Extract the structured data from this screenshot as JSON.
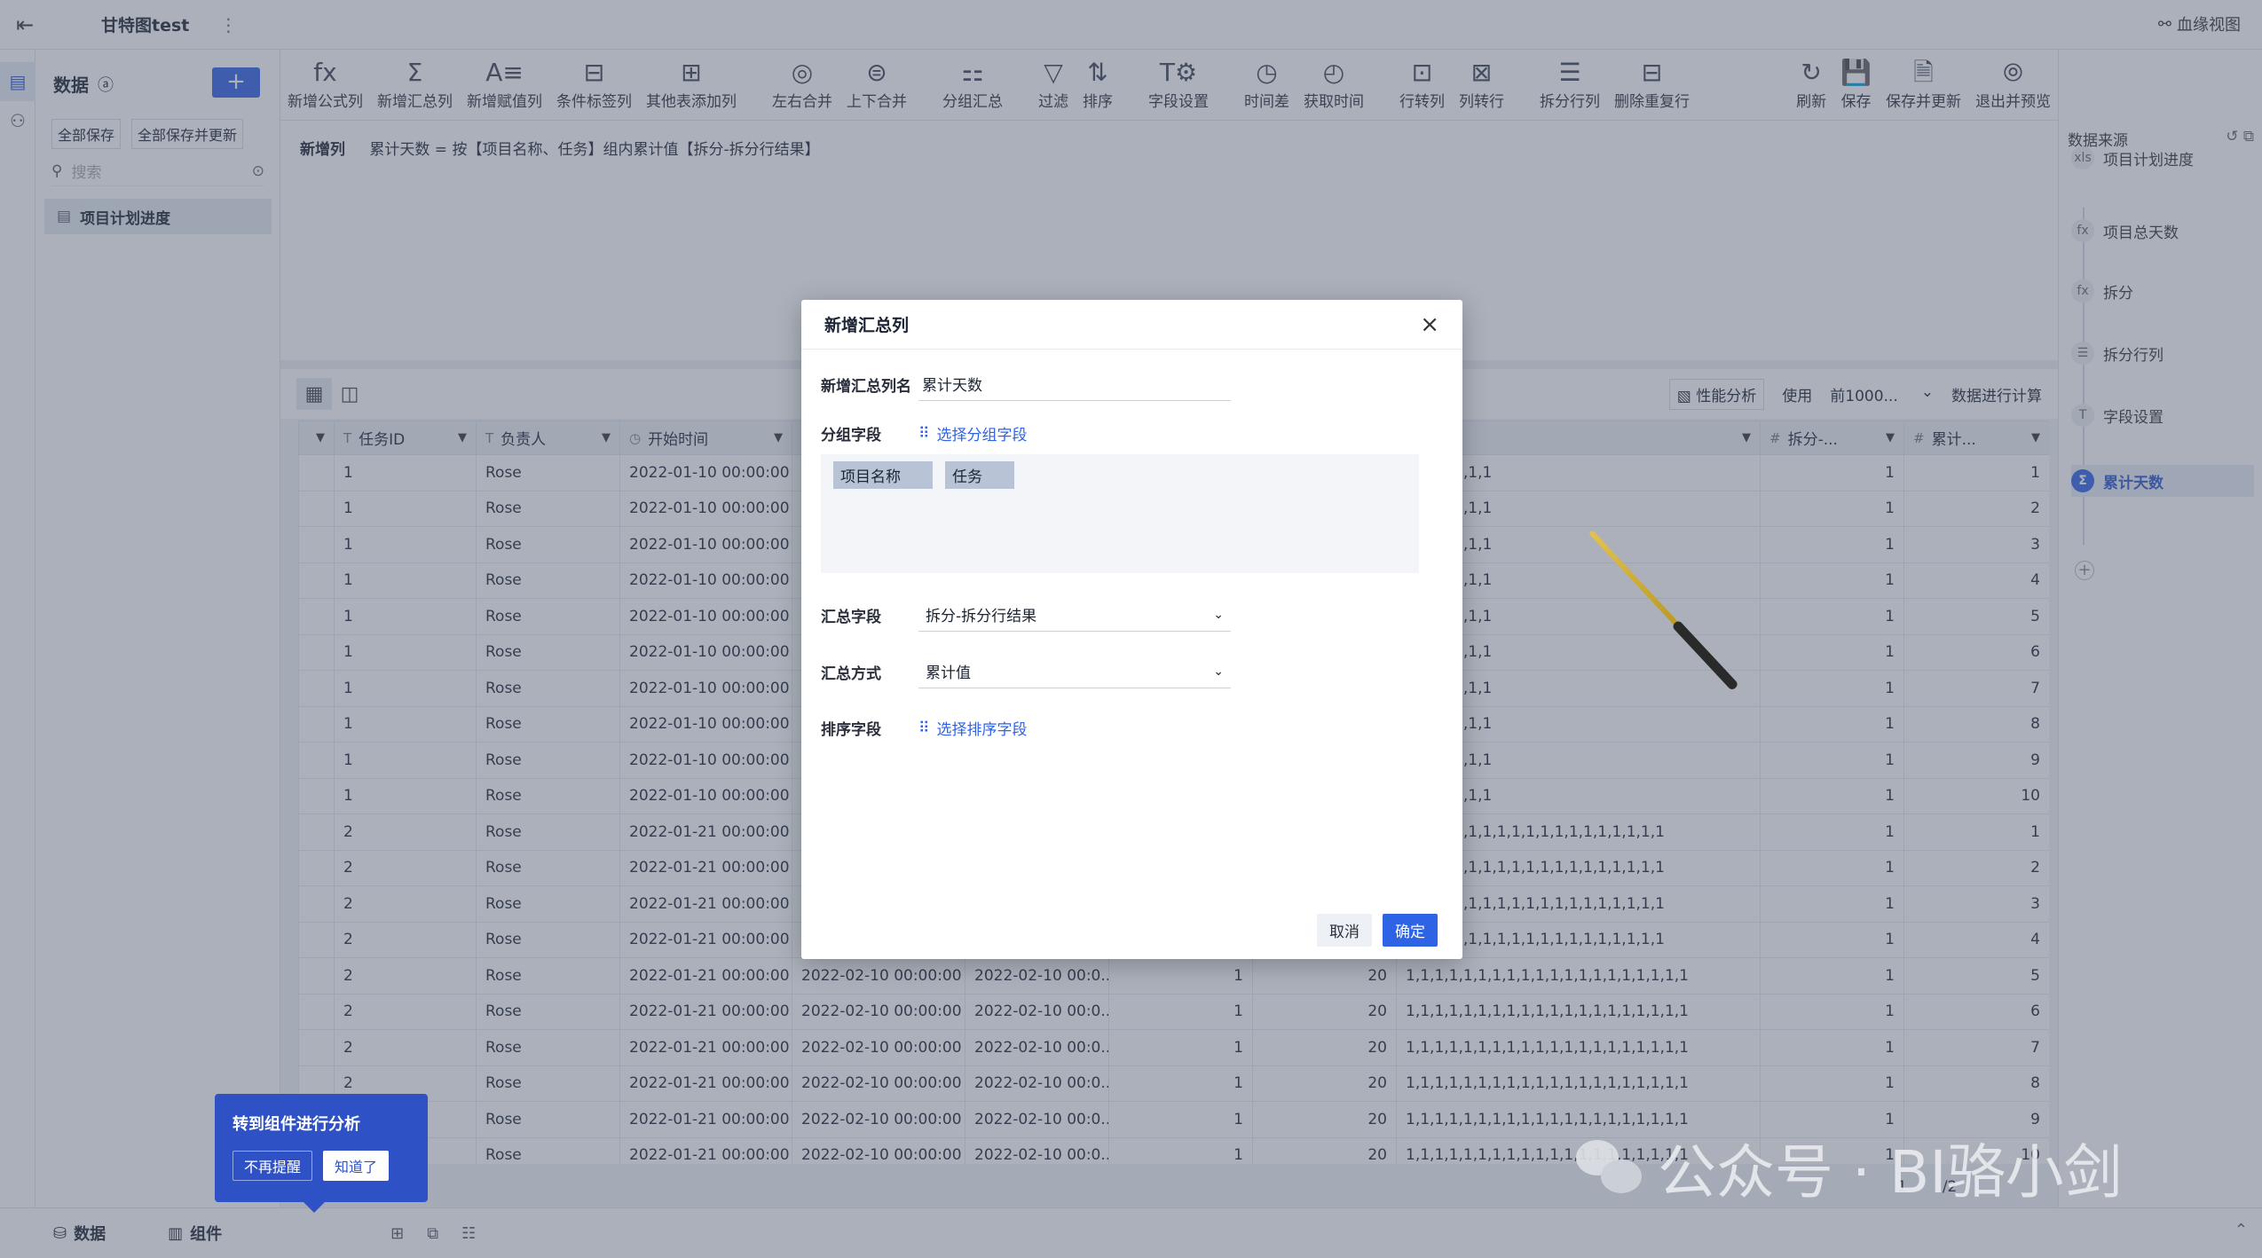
{
  "topbar": {
    "title": "甘特图test",
    "lineage": "血缘视图"
  },
  "left_panel": {
    "header": "数据",
    "add": "+",
    "save_all": "全部保存",
    "save_all_update": "全部保存并更新",
    "search_placeholder": "搜索",
    "table_name": "项目计划进度"
  },
  "toolbar": {
    "items": [
      {
        "label": "新增公式列",
        "icon": "fx"
      },
      {
        "label": "新增汇总列",
        "icon": "Σ"
      },
      {
        "label": "新增赋值列",
        "icon": "A≡"
      },
      {
        "label": "条件标签列",
        "icon": "⊟"
      },
      {
        "label": "其他表添加列",
        "icon": "⊞"
      },
      {
        "label": "左右合并",
        "icon": "◎"
      },
      {
        "label": "上下合并",
        "icon": "⊜"
      },
      {
        "label": "分组汇总",
        "icon": "⚏"
      },
      {
        "label": "过滤",
        "icon": "▽"
      },
      {
        "label": "排序",
        "icon": "⇅"
      },
      {
        "label": "字段设置",
        "icon": "T⚙"
      },
      {
        "label": "时间差",
        "icon": "◷"
      },
      {
        "label": "获取时间",
        "icon": "◴"
      },
      {
        "label": "行转列",
        "icon": "⊡"
      },
      {
        "label": "列转行",
        "icon": "⊠"
      },
      {
        "label": "拆分行列",
        "icon": "☰"
      },
      {
        "label": "删除重复行",
        "icon": "⊟"
      },
      {
        "label": "刷新",
        "icon": "↻"
      },
      {
        "label": "保存",
        "icon": "💾"
      },
      {
        "label": "保存并更新",
        "icon": "🗎"
      },
      {
        "label": "退出并预览",
        "icon": "⦾"
      }
    ]
  },
  "formula_bar": {
    "label": "新增列",
    "text": "累计天数 = 按【项目名称、任务】组内累计值【拆分-拆分行结果】"
  },
  "grid_controls": {
    "perf": "性能分析",
    "use": "使用",
    "rows": "前1000...",
    "compute": "数据进行计算"
  },
  "grid": {
    "headers": [
      {
        "label": "",
        "type": ""
      },
      {
        "label": "任务ID",
        "type": "T"
      },
      {
        "label": "负责人",
        "type": "T"
      },
      {
        "label": "开始时间",
        "type": "◷"
      },
      {
        "label": "",
        "type": ""
      },
      {
        "label": "",
        "type": ""
      },
      {
        "label": "",
        "type": ""
      },
      {
        "label": "",
        "type": ""
      },
      {
        "label": "分",
        "type": ""
      },
      {
        "label": "拆分-...",
        "type": "#"
      },
      {
        "label": "累计...",
        "type": "#"
      }
    ],
    "rows": [
      [
        "",
        "1",
        "Rose",
        "2022-01-10 00:00:00",
        "",
        "",
        "",
        "",
        ",1,1,1,1,1,1",
        "1",
        "1"
      ],
      [
        "",
        "1",
        "Rose",
        "2022-01-10 00:00:00",
        "",
        "",
        "",
        "",
        ",1,1,1,1,1,1",
        "1",
        "2"
      ],
      [
        "",
        "1",
        "Rose",
        "2022-01-10 00:00:00",
        "",
        "",
        "",
        "",
        ",1,1,1,1,1,1",
        "1",
        "3"
      ],
      [
        "",
        "1",
        "Rose",
        "2022-01-10 00:00:00",
        "",
        "",
        "",
        "",
        ",1,1,1,1,1,1",
        "1",
        "4"
      ],
      [
        "",
        "1",
        "Rose",
        "2022-01-10 00:00:00",
        "",
        "",
        "",
        "",
        ",1,1,1,1,1,1",
        "1",
        "5"
      ],
      [
        "",
        "1",
        "Rose",
        "2022-01-10 00:00:00",
        "",
        "",
        "",
        "",
        ",1,1,1,1,1,1",
        "1",
        "6"
      ],
      [
        "",
        "1",
        "Rose",
        "2022-01-10 00:00:00",
        "",
        "",
        "",
        "",
        ",1,1,1,1,1,1",
        "1",
        "7"
      ],
      [
        "",
        "1",
        "Rose",
        "2022-01-10 00:00:00",
        "",
        "",
        "",
        "",
        ",1,1,1,1,1,1",
        "1",
        "8"
      ],
      [
        "",
        "1",
        "Rose",
        "2022-01-10 00:00:00",
        "",
        "",
        "",
        "",
        ",1,1,1,1,1,1",
        "1",
        "9"
      ],
      [
        "",
        "1",
        "Rose",
        "2022-01-10 00:00:00",
        "",
        "",
        "",
        "",
        ",1,1,1,1,1,1",
        "1",
        "10"
      ],
      [
        "",
        "2",
        "Rose",
        "2022-01-21 00:00:00",
        "",
        "",
        "",
        "",
        ",1,1,1,1,1,1,1,1,1,1,1,1,1,1,1,1,1,1",
        "1",
        "1"
      ],
      [
        "",
        "2",
        "Rose",
        "2022-01-21 00:00:00",
        "",
        "",
        "",
        "",
        ",1,1,1,1,1,1,1,1,1,1,1,1,1,1,1,1,1,1",
        "1",
        "2"
      ],
      [
        "",
        "2",
        "Rose",
        "2022-01-21 00:00:00",
        "",
        "",
        "",
        "",
        ",1,1,1,1,1,1,1,1,1,1,1,1,1,1,1,1,1,1",
        "1",
        "3"
      ],
      [
        "",
        "2",
        "Rose",
        "2022-01-21 00:00:00",
        "",
        "",
        "",
        "",
        ",1,1,1,1,1,1,1,1,1,1,1,1,1,1,1,1,1,1",
        "1",
        "4"
      ],
      [
        "",
        "2",
        "Rose",
        "2022-01-21 00:00:00",
        "2022-02-10 00:00:00",
        "2022-02-10 00:0...",
        "1",
        "20",
        "1,1,1,1,1,1,1,1,1,1,1,1,1,1,1,1,1,1,1,1",
        "1",
        "5"
      ],
      [
        "",
        "2",
        "Rose",
        "2022-01-21 00:00:00",
        "2022-02-10 00:00:00",
        "2022-02-10 00:0...",
        "1",
        "20",
        "1,1,1,1,1,1,1,1,1,1,1,1,1,1,1,1,1,1,1,1",
        "1",
        "6"
      ],
      [
        "",
        "2",
        "Rose",
        "2022-01-21 00:00:00",
        "2022-02-10 00:00:00",
        "2022-02-10 00:0...",
        "1",
        "20",
        "1,1,1,1,1,1,1,1,1,1,1,1,1,1,1,1,1,1,1,1",
        "1",
        "7"
      ],
      [
        "",
        "2",
        "Rose",
        "2022-01-21 00:00:00",
        "2022-02-10 00:00:00",
        "2022-02-10 00:0...",
        "1",
        "20",
        "1,1,1,1,1,1,1,1,1,1,1,1,1,1,1,1,1,1,1,1",
        "1",
        "8"
      ],
      [
        "",
        "",
        "Rose",
        "2022-01-21 00:00:00",
        "2022-02-10 00:00:00",
        "2022-02-10 00:0...",
        "1",
        "20",
        "1,1,1,1,1,1,1,1,1,1,1,1,1,1,1,1,1,1,1,1",
        "1",
        "9"
      ],
      [
        "",
        "",
        "Rose",
        "2022-01-21 00:00:00",
        "2022-02-10 00:00:00",
        "2022-02-10 00:0...",
        "1",
        "20",
        "1,1,1,1,1,1,1,1,1,1,1,1,1,1,1,1,1,1,1,1",
        "1",
        "10"
      ]
    ]
  },
  "right_panel": {
    "header": "数据来源",
    "steps": [
      {
        "label": "项目计划进度",
        "icon": "xls",
        "active": false
      },
      {
        "label": "项目总天数",
        "icon": "fx",
        "active": false
      },
      {
        "label": "拆分",
        "icon": "fx",
        "active": false
      },
      {
        "label": "拆分行列",
        "icon": "☰",
        "active": false
      },
      {
        "label": "字段设置",
        "icon": "T",
        "active": false
      },
      {
        "label": "累计天数",
        "icon": "Σ",
        "active": true
      }
    ]
  },
  "bottom_bar": {
    "data_tab": "数据",
    "component_tab": "组件",
    "page_current": "1",
    "page_total": "/2"
  },
  "tooltip": {
    "title": "转到组件进行分析",
    "dismiss": "不再提醒",
    "ok": "知道了"
  },
  "dialog": {
    "title": "新增汇总列",
    "name_label": "新增汇总列名",
    "name_value": "累计天数",
    "group_label": "分组字段",
    "group_link": "选择分组字段",
    "group_tags": [
      "项目名称",
      "任务"
    ],
    "sum_field_label": "汇总字段",
    "sum_field_value": "拆分-拆分行结果",
    "method_label": "汇总方式",
    "method_value": "累计值",
    "sort_label": "排序字段",
    "sort_link": "选择排序字段",
    "cancel": "取消",
    "ok": "确定"
  },
  "watermark": {
    "text": "公众号 · BI骆小剑"
  }
}
